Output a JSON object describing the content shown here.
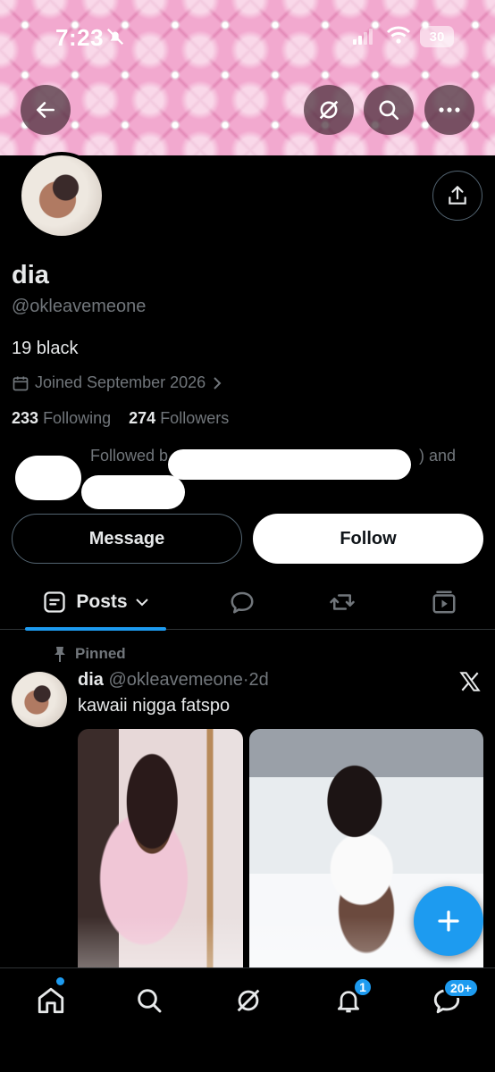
{
  "status_bar": {
    "time": "7:23",
    "battery": "30"
  },
  "profile": {
    "name": "dia",
    "handle": "@okleavemeone",
    "bio": "19 black",
    "joined": "Joined September 2026",
    "following_count": "233",
    "following_label": "Following",
    "followers_count": "274",
    "followers_label": "Followers",
    "followed_by_prefix": "Followed b",
    "followed_by_suffix": ") and"
  },
  "actions": {
    "message_label": "Message",
    "follow_label": "Follow"
  },
  "tabs": {
    "posts_label": "Posts"
  },
  "pinned_post": {
    "pinned_label": "Pinned",
    "author_name": "dia",
    "author_handle": "@okleavemeone",
    "separator": "·",
    "time": "2d",
    "text": "kawaii nigga fatspo"
  },
  "bottom_nav": {
    "notif_badge": "1",
    "messages_badge": "20+"
  },
  "colors": {
    "accent": "#1d9bf0",
    "background": "#000000",
    "muted": "#71767b",
    "banner": "#f2a9cf"
  },
  "icons": [
    "back-icon",
    "grok-icon",
    "search-icon",
    "more-icon",
    "share-icon",
    "calendar-icon",
    "chevron-right-icon",
    "list-icon",
    "chevron-down-icon",
    "replies-icon",
    "repost-icon",
    "media-icon",
    "pin-icon",
    "x-logo-icon",
    "plus-icon",
    "home-icon",
    "bell-icon",
    "messages-icon"
  ]
}
